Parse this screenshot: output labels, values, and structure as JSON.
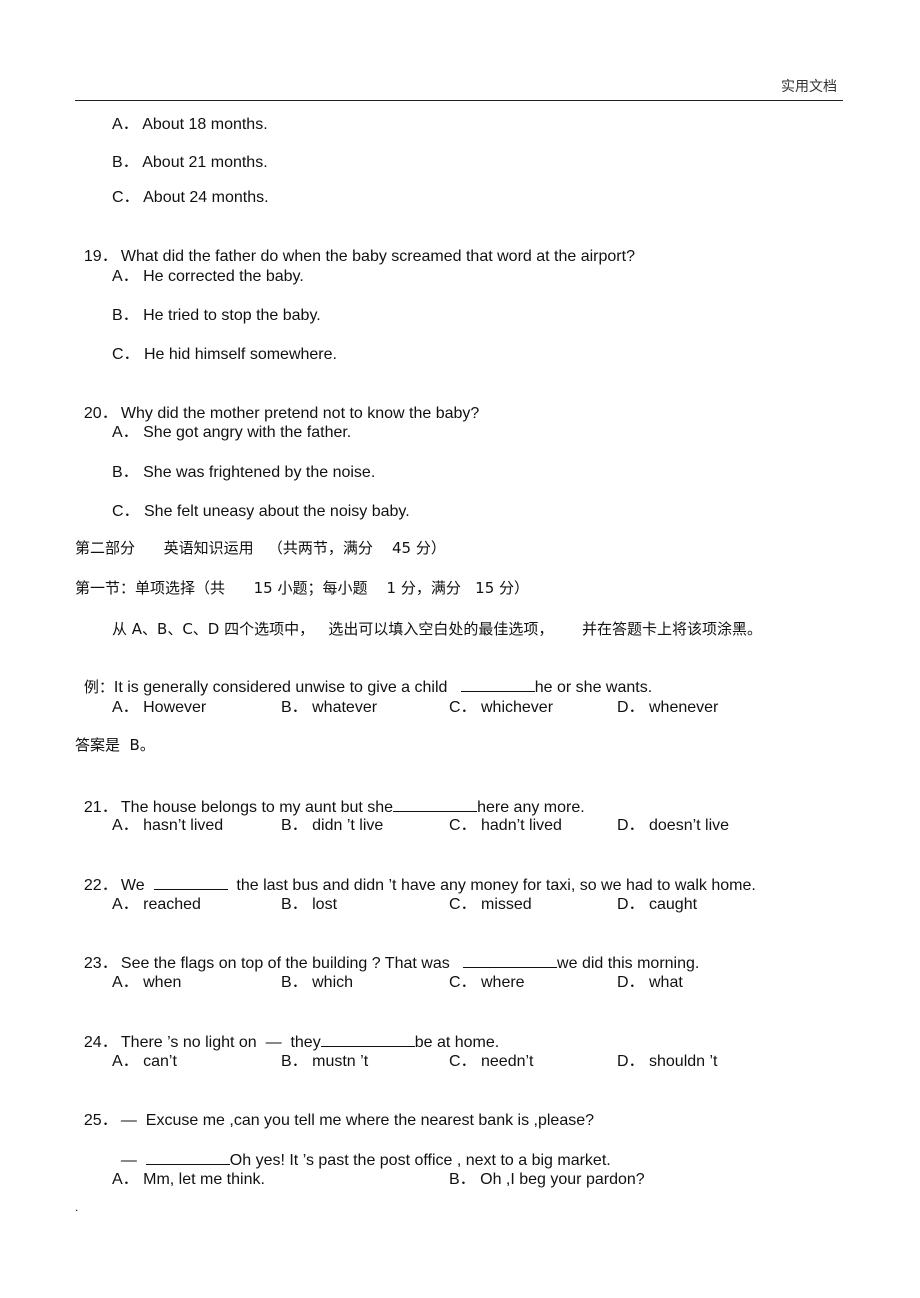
{
  "header": {
    "label": "实用文档"
  },
  "q18_options": [
    "A． About 18 months.",
    "B． About 21 months.",
    "C． About 24 months."
  ],
  "q19": {
    "num": "19．",
    "text": "What did the father do when the baby screamed that word at the airport?",
    "options": [
      "A． He corrected the baby.",
      "B． He tried to stop the baby.",
      "C． He hid himself somewhere."
    ]
  },
  "q20": {
    "num": "20．",
    "text": "Why did the mother pretend not to know the baby?",
    "options": [
      "A． She got angry with the father.",
      "B． She was frightened by the noise.",
      "C． She felt uneasy about the noisy baby."
    ]
  },
  "part2": {
    "title": "第二部分      英语知识运用   （共两节，满分    45 分）",
    "section1": "第一节：单项选择（共      15 小题；每小题    1 分，满分   15 分）",
    "instruction": "从 A、B、C、D 四个选项中，   选出可以填入空白处的最佳选项，      并在答题卡上将该项涂黑。",
    "example": {
      "prefix": "例：",
      "before": "It is generally considered unwise to give a child   ",
      "after": "he or she wants.",
      "options": [
        "A． However",
        "B． whatever",
        "C． whichever",
        "D． whenever"
      ]
    },
    "answer": "答案是  B。"
  },
  "q21": {
    "num": "21．",
    "before": "The house belongs to my aunt but she",
    "after": "here any more.",
    "options": [
      "A． hasn’t lived",
      "B． didn ’t live",
      "C． hadn’t lived",
      "D． doesn’t live"
    ]
  },
  "q22": {
    "num": "22．",
    "before": "We  ",
    "after": "  the last bus and didn ’t have any money for taxi, so we had to walk home.",
    "options": [
      "A． reached",
      "B． lost",
      "C． missed",
      "D． caught"
    ]
  },
  "q23": {
    "num": "23．",
    "before": "See the flags on top of the building ? That was   ",
    "after": "we did this morning.",
    "options": [
      "A． when",
      "B． which",
      "C． where",
      "D． what"
    ]
  },
  "q24": {
    "num": "24．",
    "before": "There ’s no light on  —  they",
    "after": "be at home.",
    "options": [
      "A． can’t",
      "B． mustn ’t",
      "C． needn’t",
      "D． shouldn ’t"
    ]
  },
  "q25": {
    "num": "25．",
    "line1": "—  Excuse me ,can you tell me where the nearest bank is ,please?",
    "dash": "—  ",
    "after": "Oh yes! It ’s past the post office , next to a big market.",
    "options": [
      "A． Mm, let me think.",
      "B． Oh ,I beg your pardon?"
    ]
  },
  "footer": "."
}
